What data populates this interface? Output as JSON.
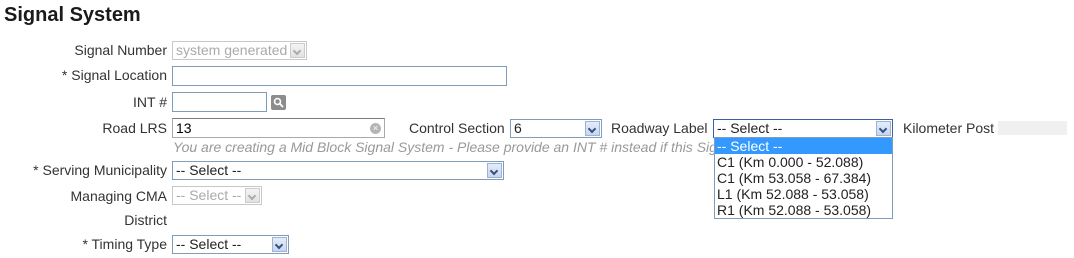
{
  "page": {
    "title": "Signal System"
  },
  "fields": {
    "signal_number": {
      "label": "Signal Number",
      "value": "system generated"
    },
    "signal_location": {
      "label": "* Signal Location",
      "value": ""
    },
    "int_number": {
      "label": "INT #",
      "value": ""
    },
    "road_lrs": {
      "label": "Road LRS",
      "value": "13"
    },
    "control_section": {
      "label": "Control Section",
      "value": "6"
    },
    "roadway_label": {
      "label": "Roadway Label",
      "value": "-- Select --"
    },
    "kilometer_post": {
      "label": "Kilometer Post"
    },
    "hint": "You are creating a Mid Block Signal System - Please provide an INT # instead if this Signal is at an intersection",
    "serving_municipality": {
      "label": "* Serving Municipality",
      "value": "-- Select --"
    },
    "managing_cma": {
      "label": "Managing CMA",
      "value": "-- Select --"
    },
    "district": {
      "label": "District"
    },
    "timing_type": {
      "label": "* Timing Type",
      "value": "-- Select --"
    }
  },
  "roadway_dropdown": {
    "options": [
      "-- Select --",
      "C1 (Km 0.000 - 52.088)",
      "C1 (Km 53.058 - 67.384)",
      "L1 (Km 52.088 - 53.058)",
      "R1 (Km 52.088 - 53.058)"
    ],
    "highlighted_index": 0
  },
  "icons": {
    "search": "search-icon",
    "clear": "clear-icon",
    "dropdown": "chevron-down-icon"
  },
  "colors": {
    "highlight": "#3399ff",
    "hint": "#999999",
    "border": "#7f9db9"
  }
}
